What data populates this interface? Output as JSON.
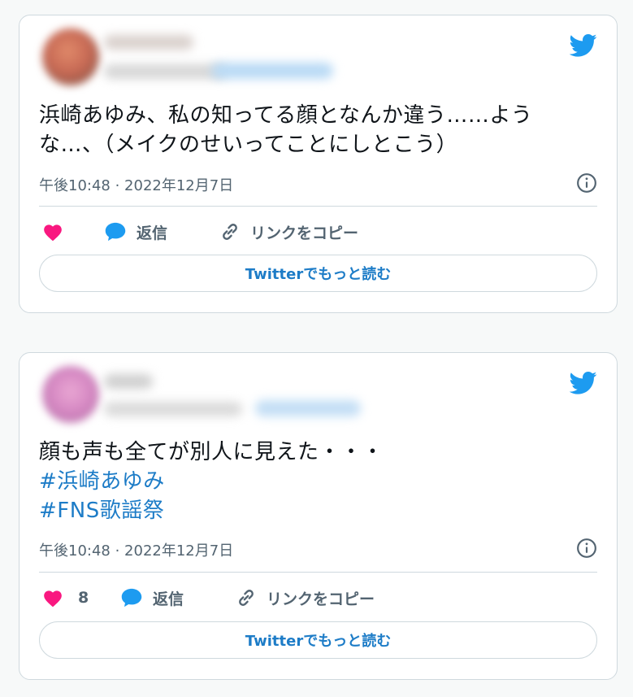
{
  "colors": {
    "accent": "#1d9bf0",
    "link": "#1d7cc7",
    "like": "#f91880",
    "muted": "#536471",
    "border": "#cfd9de"
  },
  "tweets": [
    {
      "text_lines": [
        "浜崎あゆみ、私の知ってる顔となんか違う……よう",
        "な…、（メイクのせいってことにしとこう）"
      ],
      "hashtags": [],
      "timestamp": "午後10:48 · 2022年12月7日",
      "like_count": "",
      "reply_label": "返信",
      "copy_link_label": "リンクをコピー",
      "read_more_label": "Twitterでもっと読む"
    },
    {
      "text_lines": [
        "顔も声も全てが別人に見えた・・・"
      ],
      "hashtags": [
        "#浜崎あゆみ",
        "#FNS歌謡祭"
      ],
      "timestamp": "午後10:48 · 2022年12月7日",
      "like_count": "8",
      "reply_label": "返信",
      "copy_link_label": "リンクをコピー",
      "read_more_label": "Twitterでもっと読む"
    }
  ],
  "icons": [
    "twitter-bird-icon",
    "info-icon",
    "heart-icon",
    "reply-bubble-icon",
    "link-icon"
  ]
}
